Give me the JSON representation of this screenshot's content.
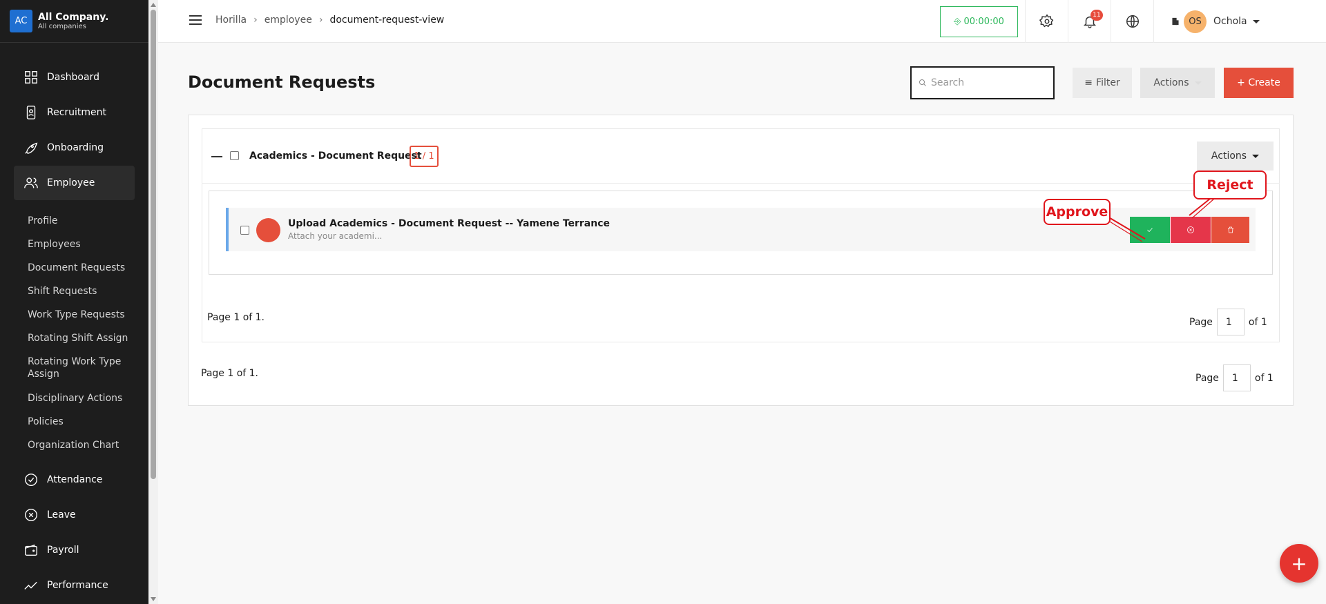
{
  "company": {
    "logo": "AC",
    "name": "All Company.",
    "sub": "All companies"
  },
  "sidebar": {
    "items": [
      {
        "label": "Dashboard",
        "icon": "dashboard-icon"
      },
      {
        "label": "Recruitment",
        "icon": "recruitment-icon"
      },
      {
        "label": "Onboarding",
        "icon": "rocket-icon"
      },
      {
        "label": "Employee",
        "icon": "users-icon"
      },
      {
        "label": "Attendance",
        "icon": "check-circle-icon"
      },
      {
        "label": "Leave",
        "icon": "x-circle-icon"
      },
      {
        "label": "Payroll",
        "icon": "wallet-icon"
      },
      {
        "label": "Performance",
        "icon": "trend-icon"
      }
    ],
    "employee_sub": [
      "Profile",
      "Employees",
      "Document Requests",
      "Shift Requests",
      "Work Type Requests",
      "Rotating Shift Assign",
      "Rotating Work Type Assign",
      "Disciplinary Actions",
      "Policies",
      "Organization Chart"
    ]
  },
  "header": {
    "breadcrumb": [
      "Horilla",
      "employee",
      "document-request-view"
    ],
    "timer": "00:00:00",
    "notification_count": "11",
    "user_initials": "OS",
    "user_name": "Ochola"
  },
  "page": {
    "title": "Document Requests",
    "search_placeholder": "Search",
    "filter_label": "Filter",
    "actions_label": "Actions",
    "create_label": "+ Create"
  },
  "group": {
    "title": "Academics - Document Request",
    "count": "1 / 1",
    "actions_label": "Actions"
  },
  "row": {
    "title": "Upload Academics - Document Request -- Yamene Terrance",
    "subtitle": "Attach your academi..."
  },
  "pagination": {
    "inner_text": "Page 1 of 1.",
    "outer_text": "Page 1 of 1.",
    "page_label": "Page",
    "page_value": "1",
    "of_label": "of 1"
  },
  "annotations": {
    "approve": "Approve",
    "reject": "Reject"
  },
  "colors": {
    "primary": "#e54f3b",
    "approve": "#1fb35c",
    "reject": "#e5364a",
    "timer": "#2eb85c",
    "sidebar": "#1d1d1d"
  }
}
